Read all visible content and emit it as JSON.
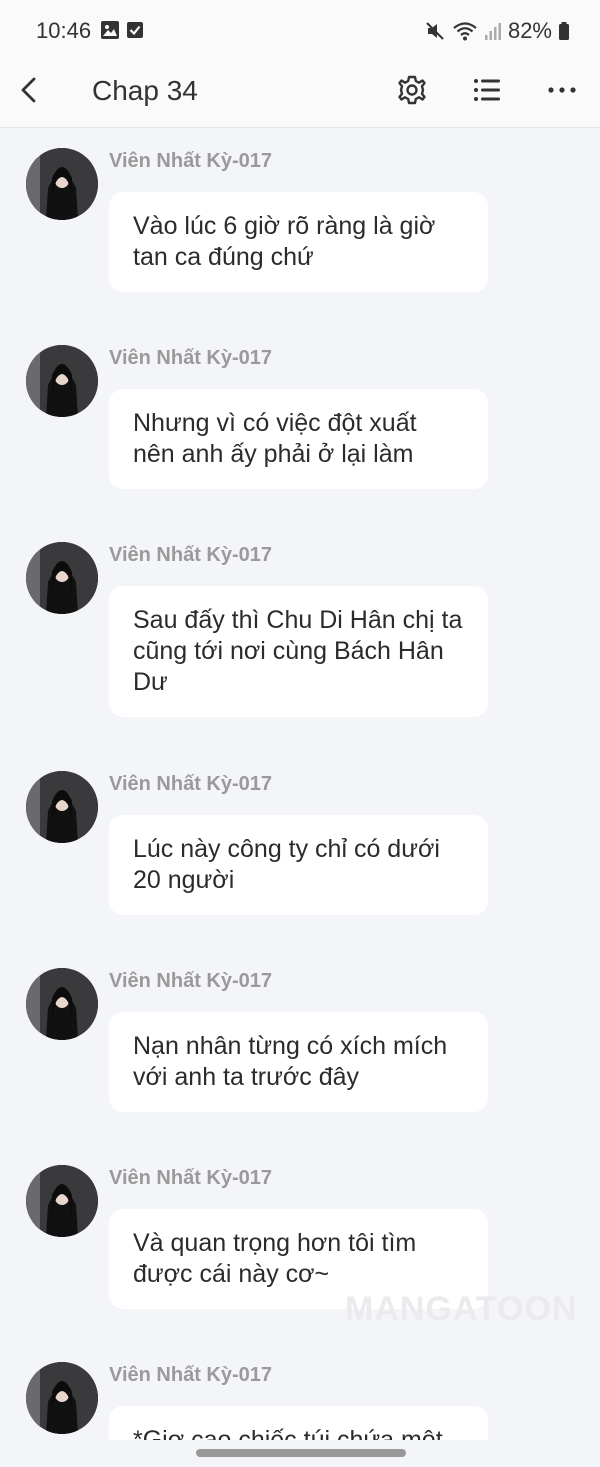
{
  "status_bar": {
    "time": "10:46",
    "battery": "82%"
  },
  "header": {
    "title": "Chap 34"
  },
  "messages": [
    {
      "sender": "Viên Nhất Kỳ-017",
      "text": "Vào lúc 6 giờ rõ ràng là giờ tan ca đúng chứ"
    },
    {
      "sender": "Viên Nhất Kỳ-017",
      "text": "Nhưng vì có việc đột xuất nên anh ấy phải ở lại làm"
    },
    {
      "sender": "Viên Nhất Kỳ-017",
      "text": "Sau đấy thì Chu Di Hân chị ta cũng tới nơi cùng Bách Hân Dư"
    },
    {
      "sender": "Viên Nhất Kỳ-017",
      "text": "Lúc này công ty chỉ có dưới 20 người"
    },
    {
      "sender": "Viên Nhất Kỳ-017",
      "text": "Nạn nhân từng có xích mích với anh ta trước đây"
    },
    {
      "sender": "Viên Nhất Kỳ-017",
      "text": "Và quan trọng hơn tôi tìm được cái này cơ~"
    },
    {
      "sender": "Viên Nhất Kỳ-017",
      "text": "*Giơ cao chiếc túi chứa một"
    }
  ],
  "watermark": "MANGATOON",
  "icons": {
    "status_left": [
      "gallery-icon",
      "checkbox-icon"
    ],
    "status_right": [
      "mute-icon",
      "wifi-icon",
      "signal-icon",
      "battery-icon"
    ],
    "header": [
      "back-arrow-icon",
      "settings-gear-icon",
      "list-icon",
      "more-dots-icon"
    ]
  }
}
